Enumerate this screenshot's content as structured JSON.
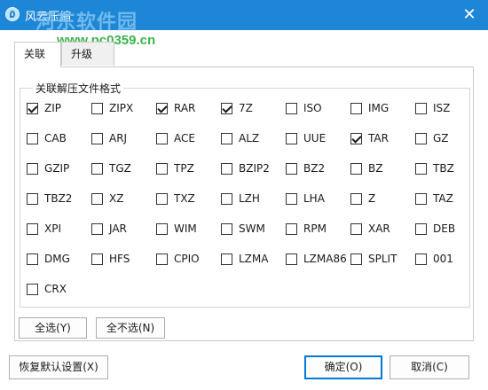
{
  "window": {
    "title": "风云压缩",
    "close_glyph": "✕"
  },
  "watermark": {
    "site_name": "河东软件园",
    "url": "www.pc0359.cn"
  },
  "tabs": [
    {
      "label": "关联",
      "active": true
    },
    {
      "label": "升级",
      "active": false
    }
  ],
  "group": {
    "title": "关联解压文件格式"
  },
  "formats": [
    {
      "label": "ZIP",
      "checked": true
    },
    {
      "label": "ZIPX",
      "checked": false
    },
    {
      "label": "RAR",
      "checked": true
    },
    {
      "label": "7Z",
      "checked": true
    },
    {
      "label": "ISO",
      "checked": false
    },
    {
      "label": "IMG",
      "checked": false
    },
    {
      "label": "ISZ",
      "checked": false
    },
    {
      "label": "CAB",
      "checked": false
    },
    {
      "label": "ARJ",
      "checked": false
    },
    {
      "label": "ACE",
      "checked": false
    },
    {
      "label": "ALZ",
      "checked": false
    },
    {
      "label": "UUE",
      "checked": false
    },
    {
      "label": "TAR",
      "checked": true
    },
    {
      "label": "GZ",
      "checked": false
    },
    {
      "label": "GZIP",
      "checked": false
    },
    {
      "label": "TGZ",
      "checked": false
    },
    {
      "label": "TPZ",
      "checked": false
    },
    {
      "label": "BZIP2",
      "checked": false
    },
    {
      "label": "BZ2",
      "checked": false
    },
    {
      "label": "BZ",
      "checked": false
    },
    {
      "label": "TBZ",
      "checked": false
    },
    {
      "label": "TBZ2",
      "checked": false
    },
    {
      "label": "XZ",
      "checked": false
    },
    {
      "label": "TXZ",
      "checked": false
    },
    {
      "label": "LZH",
      "checked": false
    },
    {
      "label": "LHA",
      "checked": false
    },
    {
      "label": "Z",
      "checked": false
    },
    {
      "label": "TAZ",
      "checked": false
    },
    {
      "label": "XPI",
      "checked": false
    },
    {
      "label": "JAR",
      "checked": false
    },
    {
      "label": "WIM",
      "checked": false
    },
    {
      "label": "SWM",
      "checked": false
    },
    {
      "label": "RPM",
      "checked": false
    },
    {
      "label": "XAR",
      "checked": false
    },
    {
      "label": "DEB",
      "checked": false
    },
    {
      "label": "DMG",
      "checked": false
    },
    {
      "label": "HFS",
      "checked": false
    },
    {
      "label": "CPIO",
      "checked": false
    },
    {
      "label": "LZMA",
      "checked": false
    },
    {
      "label": "LZMA86",
      "checked": false
    },
    {
      "label": "SPLIT",
      "checked": false
    },
    {
      "label": "001",
      "checked": false
    },
    {
      "label": "CRX",
      "checked": false
    }
  ],
  "buttons": {
    "select_all": "全选(Y)",
    "select_none": "全不选(N)",
    "restore_default": "恢复默认设置(X)",
    "ok": "确定(O)",
    "cancel": "取消(C)"
  },
  "colors": {
    "titlebar": "#1d86d6",
    "primary_border": "#0078d7"
  }
}
